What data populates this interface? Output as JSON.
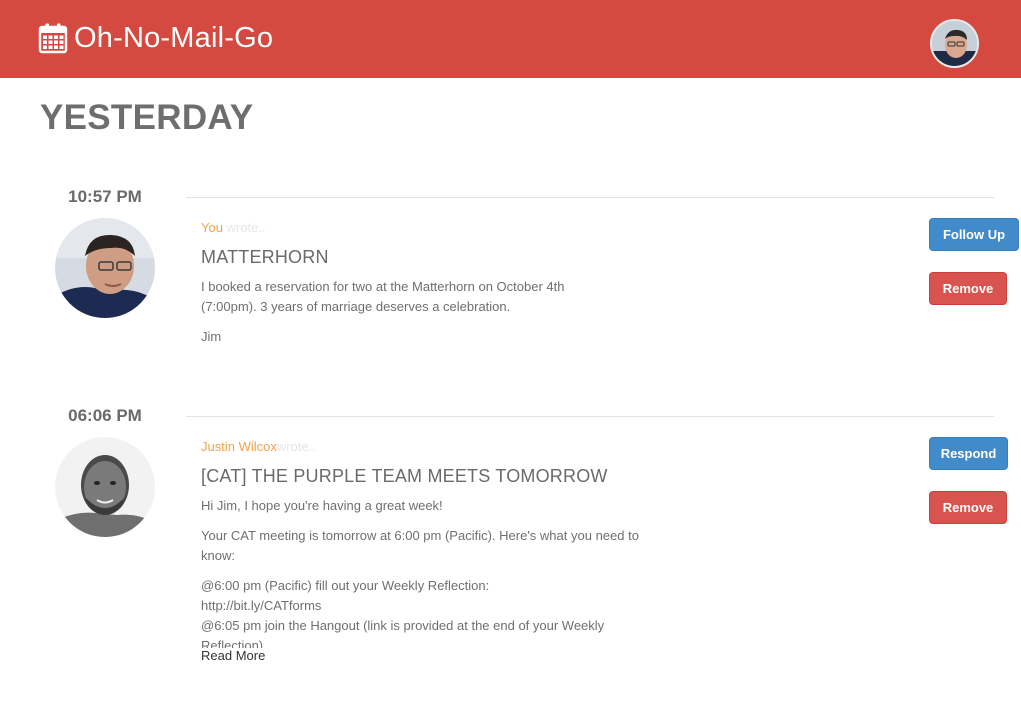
{
  "header": {
    "app_name": "Oh-No-Mail-Go",
    "logo_icon": "calendar-icon",
    "bar_color": "#d54a40"
  },
  "section": {
    "title": "YESTERDAY"
  },
  "messages": [
    {
      "time": "10:57 PM",
      "sender": "You",
      "wrote": "wrote..",
      "subject": "MATTERHORN",
      "body_lines": [
        "I booked a reservation for two at the Matterhorn on October 4th",
        "(7:00pm). 3 years of marriage deserves a celebration."
      ],
      "signature": "Jim",
      "primary_action": "Follow Up",
      "remove_action": "Remove"
    },
    {
      "time": "06:06 PM",
      "sender": "Justin Wilcox",
      "wrote": "wrote..",
      "subject": "[CAT] THE PURPLE TEAM MEETS TOMORROW",
      "greeting": "Hi Jim, I hope you're having a great week!",
      "para2_lines": [
        "Your CAT meeting is tomorrow at 6:00 pm (Pacific). Here's what you need to",
        "know:"
      ],
      "para3_lines": [
        "@6:00 pm (Pacific) fill out your Weekly Reflection:",
        "http://bit.ly/CATforms",
        "@6:05 pm join the Hangout (link is provided at the end of your Weekly",
        "Reflection)"
      ],
      "read_more": "Read More",
      "primary_action": "Respond",
      "remove_action": "Remove"
    }
  ],
  "colors": {
    "accent_blue": "#428bca",
    "danger_red": "#d9534f",
    "sender_orange": "#f0a44f"
  }
}
